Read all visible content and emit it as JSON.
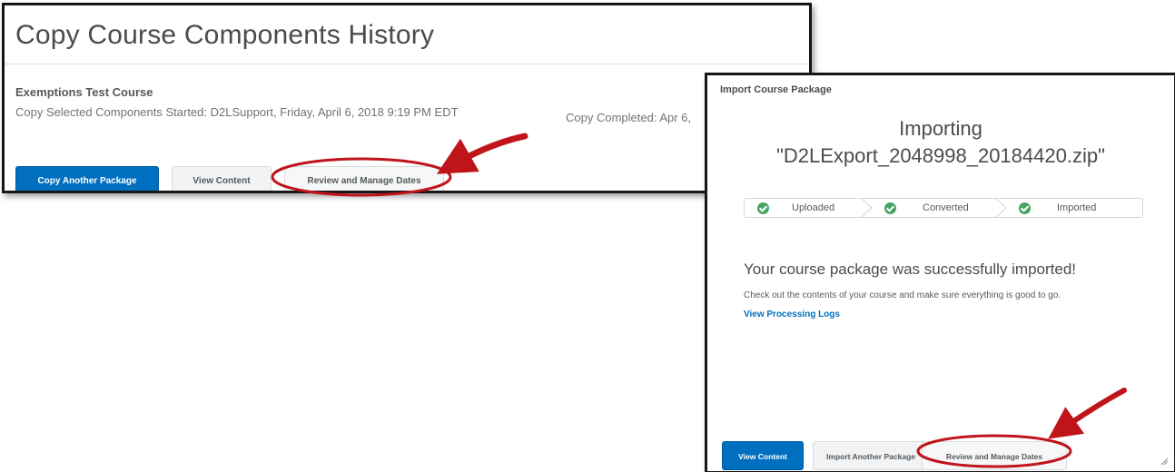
{
  "history_panel": {
    "title": "Copy Course Components History",
    "course_name": "Exemptions Test Course",
    "copy_started": "Copy Selected Components Started: D2LSupport, Friday, April 6, 2018 9:19 PM EDT",
    "copy_completed": "Copy Completed: Apr 6,",
    "buttons": {
      "copy_another": "Copy Another Package",
      "view_content": "View Content",
      "review_dates": "Review and Manage Dates"
    }
  },
  "import_dialog": {
    "header": "Import Course Package",
    "heading_line1": "Importing",
    "heading_line2": "\"D2LExport_2048998_20184420.zip\"",
    "steps": [
      {
        "label": "Uploaded",
        "status": "complete"
      },
      {
        "label": "Converted",
        "status": "complete"
      },
      {
        "label": "Imported",
        "status": "complete"
      }
    ],
    "success_message": "Your course package was successfully imported!",
    "success_sub": "Check out the contents of your course and make sure everything is good to go.",
    "logs_link": "View Processing Logs",
    "buttons": {
      "view_content": "View Content",
      "import_another": "Import Another Package",
      "review_dates": "Review and Manage Dates"
    }
  },
  "colors": {
    "primary_button": "#006fbf",
    "success_check": "#46a661",
    "annotation_red": "#c0141b",
    "link": "#006fbf"
  }
}
